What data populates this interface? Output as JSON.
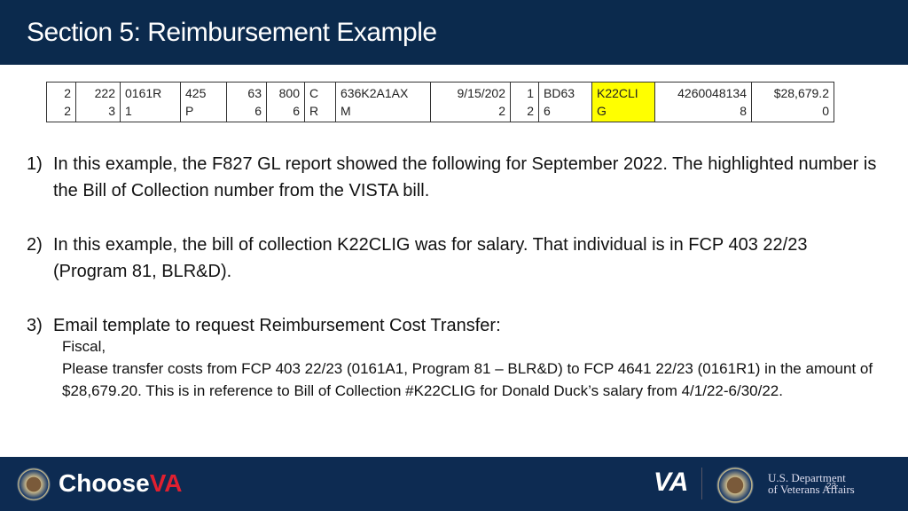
{
  "header": {
    "title": "Section 5: Reimbursement Example"
  },
  "table": {
    "row": [
      {
        "top": "2",
        "bottom": "2",
        "align": "r"
      },
      {
        "top": "222",
        "bottom": "3",
        "align": "r"
      },
      {
        "top": "0161R",
        "bottom": "1",
        "align": "l"
      },
      {
        "top": "425",
        "bottom": "P",
        "align": "l"
      },
      {
        "top": "63",
        "bottom": "6",
        "align": "r"
      },
      {
        "top": "800",
        "bottom": "6",
        "align": "r"
      },
      {
        "top": "C",
        "bottom": "R",
        "align": "l"
      },
      {
        "top": "636K2A1AX",
        "bottom": "M",
        "align": "l"
      },
      {
        "top": "9/15/202",
        "bottom": "2",
        "align": "r"
      },
      {
        "top": "1",
        "bottom": "2",
        "align": "r"
      },
      {
        "top": "BD63",
        "bottom": "6",
        "align": "l"
      },
      {
        "top": "K22CLI",
        "bottom": "G",
        "align": "l",
        "highlight": true
      },
      {
        "top": "4260048134",
        "bottom": "8",
        "align": "r"
      },
      {
        "top": "$28,679.2",
        "bottom": "0",
        "align": "r"
      }
    ],
    "highlight_color": "#ffff00"
  },
  "items": [
    {
      "num": "1)",
      "text": "In this example, the F827 GL report showed the following for September 2022. The highlighted number is the Bill of Collection number from the VISTA bill."
    },
    {
      "num": "2)",
      "text": "In this example, the bill of collection K22CLIG was for salary. That individual is in FCP 403 22/23 (Program 81, BLR&D)."
    },
    {
      "num": "3)",
      "text": "Email template to request Reimbursement Cost Transfer:"
    }
  ],
  "email": {
    "greeting": "Fiscal,",
    "body": "Please transfer costs from FCP 403 22/23 (0161A1, Program 81 – BLR&D) to FCP 4641 22/23 (0161R1) in the amount of $28,679.20. This is in reference to Bill of Collection #K22CLIG for Donald Duck’s salary from 4/1/22-6/30/22."
  },
  "footer": {
    "choose": "Choose",
    "va_mark": "VA",
    "va_logo": "VA",
    "dept_line1": "U.S. Department",
    "dept_line2": "of Veterans Affairs",
    "page_number": "23"
  }
}
